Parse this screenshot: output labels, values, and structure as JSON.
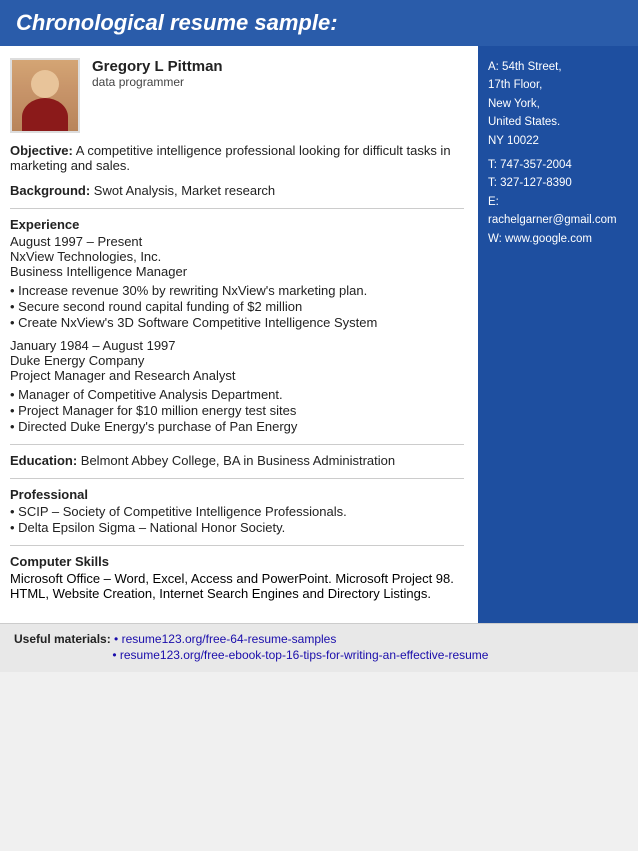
{
  "header": {
    "title": "Chronological resume sample:"
  },
  "profile": {
    "name": "Gregory L Pittman",
    "title": "data programmer"
  },
  "sidebar": {
    "address_line1": "A: 54th Street,",
    "address_line2": "17th Floor,",
    "address_line3": "New York,",
    "address_line4": "United States.",
    "address_line5": "NY 10022",
    "phone1_label": "T:",
    "phone1": "747-357-2004",
    "phone2_label": "T:",
    "phone2": "327-127-8390",
    "email_label": "E:",
    "email": "rachelgarner@gmail.com",
    "web_label": "W:",
    "web": "www.google.com"
  },
  "objective": {
    "label": "Objective:",
    "text": " A competitive intelligence professional looking for difficult tasks in marketing and sales."
  },
  "background": {
    "label": "Background:",
    "text": " Swot Analysis, Market research"
  },
  "experience": {
    "heading": "Experience",
    "jobs": [
      {
        "dates": "August 1997 – Present",
        "company": "NxView Technologies, Inc.",
        "role": "Business Intelligence Manager",
        "bullets": [
          "Increase revenue 30% by rewriting NxView's marketing plan.",
          "Secure second round capital funding of $2 million",
          "Create NxView's 3D Software Competitive Intelligence System"
        ]
      },
      {
        "dates": "January 1984 – August 1997",
        "company": "Duke Energy Company",
        "role": "Project Manager and Research Analyst",
        "bullets": [
          "Manager of Competitive Analysis Department.",
          "Project Manager for $10 million energy test sites",
          "Directed Duke Energy's purchase of Pan Energy"
        ]
      }
    ]
  },
  "education": {
    "label": "Education:",
    "text": " Belmont Abbey College, BA in Business Administration"
  },
  "professional": {
    "heading": "Professional",
    "bullets": [
      "SCIP – Society of Competitive Intelligence Professionals.",
      "Delta Epsilon Sigma – National Honor Society."
    ]
  },
  "computer_skills": {
    "heading": "Computer Skills",
    "text": "Microsoft Office – Word, Excel, Access and PowerPoint. Microsoft Project 98. HTML, Website Creation, Internet Search Engines and Directory Listings."
  },
  "footer": {
    "label": "Useful materials:",
    "links": [
      "• resume123.org/free-64-resume-samples",
      "• resume123.org/free-ebook-top-16-tips-for-writing-an-effective-resume"
    ]
  }
}
